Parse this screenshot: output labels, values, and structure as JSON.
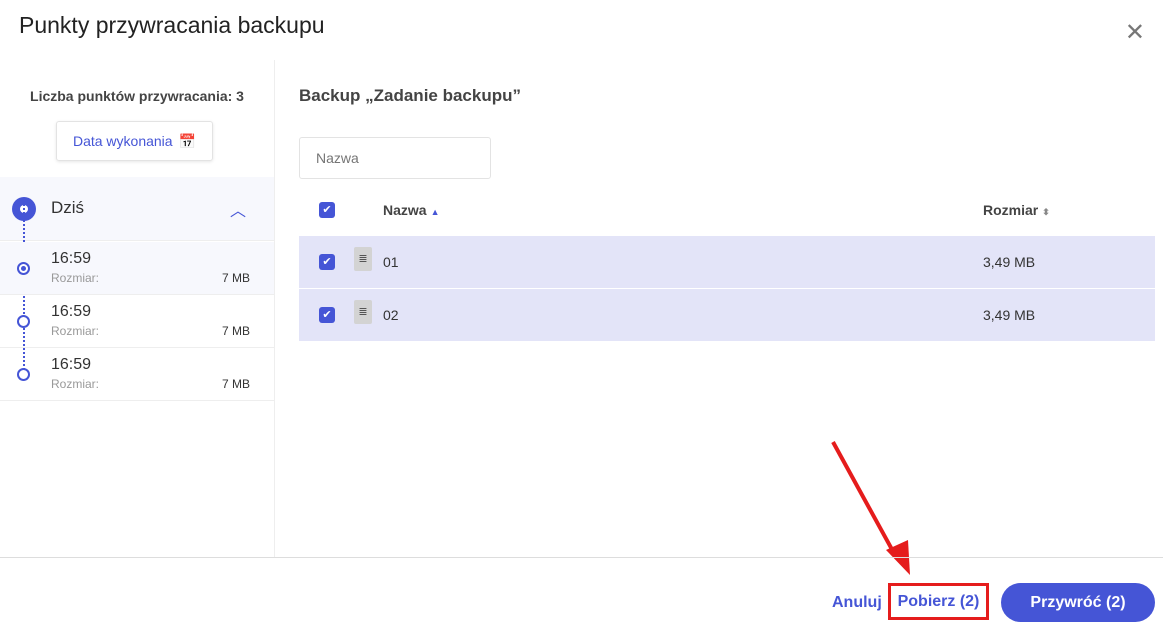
{
  "title": "Punkty przywracania backupu",
  "left": {
    "count_label": "Liczba punktów przywracania: 3",
    "date_button": "Data wykonania",
    "group": "Dziś",
    "items": [
      {
        "time": "16:59",
        "size_label": "Rozmiar:",
        "size": "7 MB"
      },
      {
        "time": "16:59",
        "size_label": "Rozmiar:",
        "size": "7 MB"
      },
      {
        "time": "16:59",
        "size_label": "Rozmiar:",
        "size": "7 MB"
      }
    ]
  },
  "main": {
    "heading": "Backup „Zadanie backupu”",
    "search_placeholder": "Nazwa",
    "columns": {
      "name": "Nazwa",
      "size": "Rozmiar"
    },
    "rows": [
      {
        "name": "01",
        "size": "3,49 MB"
      },
      {
        "name": "02",
        "size": "3,49 MB"
      }
    ]
  },
  "footer": {
    "cancel": "Anuluj",
    "download": "Pobierz (2)",
    "restore": "Przywróć (2)"
  },
  "colors": {
    "accent": "#4555d6",
    "highlight": "#e51c1c"
  }
}
